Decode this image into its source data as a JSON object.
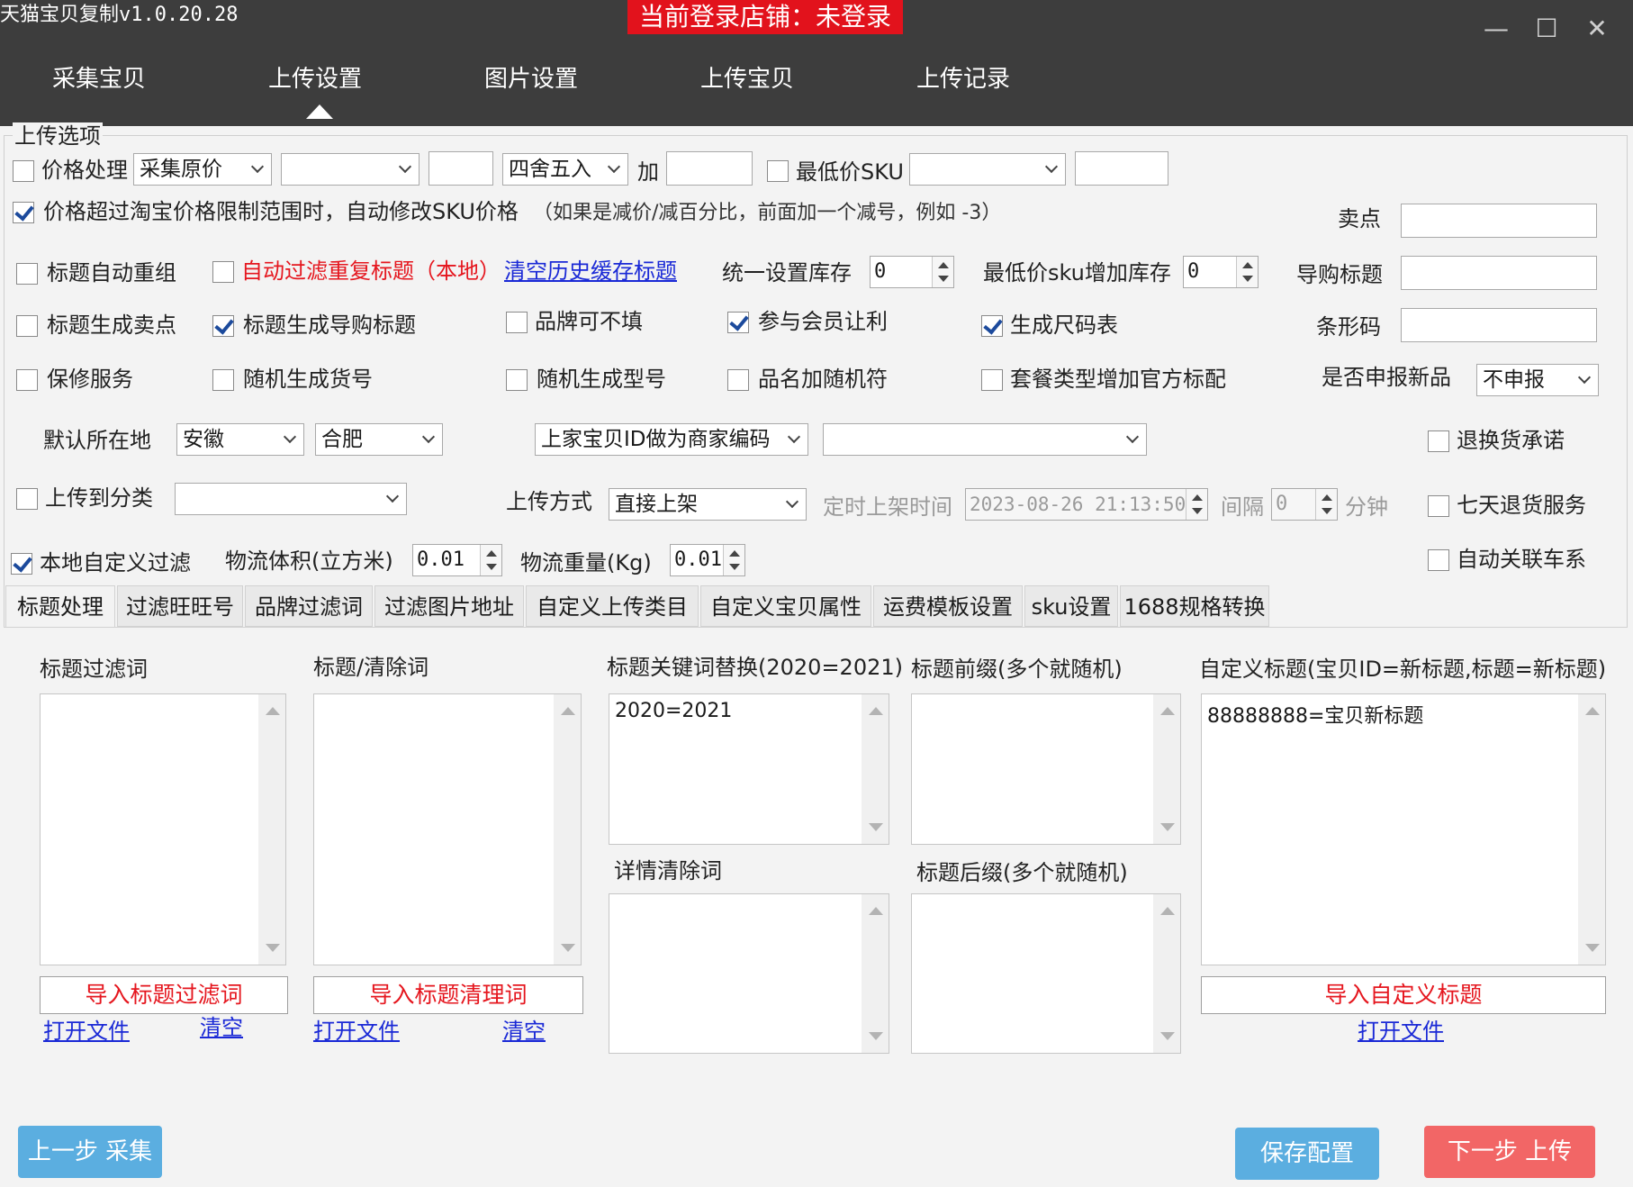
{
  "app": {
    "title": "天猫宝贝复制v1.0.20.28",
    "login_status": "当前登录店铺：未登录"
  },
  "window": {
    "minimize": "—",
    "maximize": "☐",
    "close": "✕"
  },
  "nav": {
    "tabs": [
      "采集宝贝",
      "上传设置",
      "图片设置",
      "上传宝贝",
      "上传记录"
    ],
    "active_index": 1
  },
  "options": {
    "group_title": "上传选项",
    "price_processing": {
      "label": "价格处理",
      "checked": false,
      "mode": "采集原价",
      "mode2": "",
      "value": "",
      "rounding": "四舍五入",
      "add_label": "加",
      "add_value": ""
    },
    "min_sku": {
      "label": "最低价SKU",
      "checked": false,
      "select": "",
      "value": ""
    },
    "auto_fix_price": {
      "label": "价格超过淘宝价格限制范围时，自动修改SKU价格",
      "checked": true,
      "hint": "（如果是减价/减百分比，前面加一个减号，例如 -3）"
    },
    "selling_point": {
      "label": "卖点",
      "value": ""
    },
    "title_regroup": {
      "label": "标题自动重组",
      "checked": false
    },
    "filter_dup_titles": {
      "label": "自动过滤重复标题（本地）",
      "checked": false
    },
    "clear_cache_link": "清空历史缓存标题",
    "unified_stock": {
      "label": "统一设置库存",
      "value": "0"
    },
    "min_sku_stock": {
      "label": "最低价sku增加库存",
      "value": "0"
    },
    "guide_title": {
      "label": "导购标题",
      "value": ""
    },
    "title_to_selling": {
      "label": "标题生成卖点",
      "checked": false
    },
    "title_to_guide": {
      "label": "标题生成导购标题",
      "checked": true
    },
    "brand_optional": {
      "label": "品牌可不填",
      "checked": false
    },
    "member_discount": {
      "label": "参与会员让利",
      "checked": true
    },
    "size_chart": {
      "label": "生成尺码表",
      "checked": true
    },
    "barcode": {
      "label": "条形码",
      "value": ""
    },
    "warranty": {
      "label": "保修服务",
      "checked": false
    },
    "random_item_no": {
      "label": "随机生成货号",
      "checked": false
    },
    "random_model_no": {
      "label": "随机生成型号",
      "checked": false
    },
    "random_name_char": {
      "label": "品名加随机符",
      "checked": false
    },
    "package_official": {
      "label": "套餐类型增加官方标配",
      "checked": false
    },
    "new_product": {
      "label": "是否申报新品",
      "value": "不申报"
    },
    "location": {
      "label": "默认所在地",
      "province": "安徽",
      "city": "合肥"
    },
    "merchant_code": {
      "value": "上家宝贝ID做为商家编码",
      "extra": ""
    },
    "return_promise": {
      "label": "退换货承诺",
      "checked": false
    },
    "upload_category": {
      "label": "上传到分类",
      "checked": false,
      "value": ""
    },
    "upload_mode": {
      "label": "上传方式",
      "value": "直接上架"
    },
    "scheduled": {
      "label": "定时上架时间",
      "value": "2023-08-26 21:13:50",
      "interval_label": "间隔",
      "interval_value": "0",
      "unit": "分钟"
    },
    "seven_day_return": {
      "label": "七天退货服务",
      "checked": false
    },
    "local_filter": {
      "label": "本地自定义过滤",
      "checked": true
    },
    "volume": {
      "label": "物流体积(立方米)",
      "value": "0.01"
    },
    "weight": {
      "label": "物流重量(Kg)",
      "value": "0.01"
    },
    "auto_car": {
      "label": "自动关联车系",
      "checked": false
    }
  },
  "subtabs": {
    "items": [
      "标题处理",
      "过滤旺旺号",
      "品牌过滤词",
      "过滤图片地址",
      "自定义上传类目",
      "自定义宝贝属性",
      "运费模板设置",
      "sku设置",
      "1688规格转换"
    ],
    "active_index": 0
  },
  "title_panel": {
    "filter_words": {
      "label": "标题过滤词",
      "content": "",
      "import_btn": "导入标题过滤词",
      "open_link": "打开文件",
      "clear_link": "清空"
    },
    "clear_words": {
      "label": "标题/清除词",
      "content": "",
      "import_btn": "导入标题清理词",
      "open_link": "打开文件",
      "clear_link": "清空"
    },
    "keyword_replace": {
      "label": "标题关键词替换(2020=2021)",
      "content": "2020=2021"
    },
    "detail_clear": {
      "label": "详情清除词",
      "content": ""
    },
    "prefix": {
      "label": "标题前缀(多个就随机)",
      "content": ""
    },
    "suffix": {
      "label": "标题后缀(多个就随机)",
      "content": ""
    },
    "custom_title": {
      "label": "自定义标题(宝贝ID=新标题,标题=新标题)",
      "content": "88888888=宝贝新标题",
      "import_btn": "导入自定义标题",
      "open_link": "打开文件"
    }
  },
  "footer": {
    "prev": "上一步 采集",
    "save": "保存配置",
    "next": "下一步 上传"
  }
}
